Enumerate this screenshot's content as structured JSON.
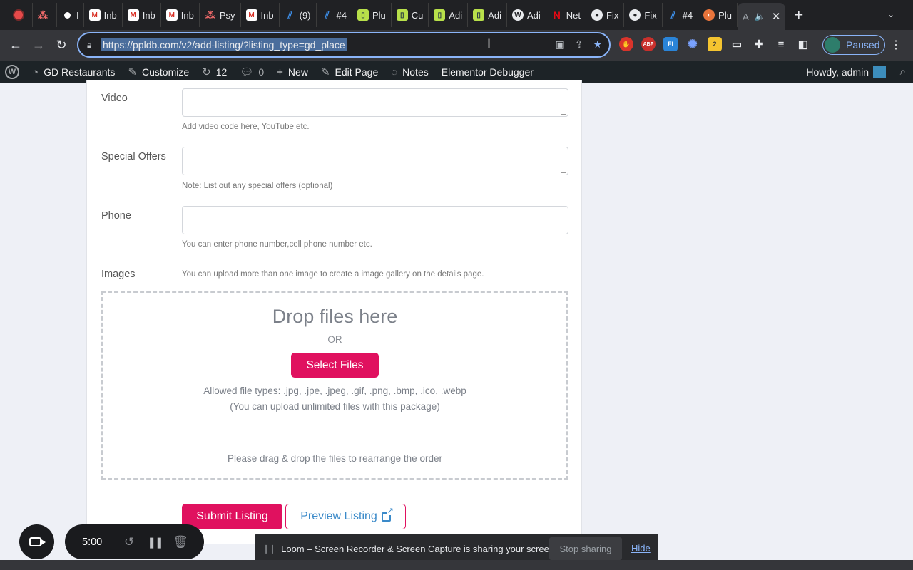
{
  "browser": {
    "tabs": [
      {
        "label": "",
        "icon": "recording-icon",
        "fav": "rec",
        "narrow": true
      },
      {
        "label": "",
        "icon": "asana-icon",
        "fav": "asana",
        "narrow": true
      },
      {
        "label": "I",
        "icon": "dot-icon",
        "fav": "dot",
        "narrow": true
      },
      {
        "label": "Inb",
        "icon": "gmail-icon",
        "fav": "gmail"
      },
      {
        "label": "Inb",
        "icon": "gmail-icon",
        "fav": "gmail"
      },
      {
        "label": "Inb",
        "icon": "gmail-icon",
        "fav": "gmail"
      },
      {
        "label": "Psy",
        "icon": "asana-icon",
        "fav": "asana"
      },
      {
        "label": "Inb",
        "icon": "gmail-icon",
        "fav": "gmail"
      },
      {
        "label": "(9)",
        "icon": "zenhub-icon",
        "fav": "zen"
      },
      {
        "label": "#4",
        "icon": "zenhub-icon",
        "fav": "zen"
      },
      {
        "label": "Plu",
        "icon": "plugin-icon",
        "fav": "plug"
      },
      {
        "label": "Cu",
        "icon": "plugin-icon",
        "fav": "plug"
      },
      {
        "label": "Adi",
        "icon": "plugin-icon",
        "fav": "plug"
      },
      {
        "label": "Adi",
        "icon": "plugin-icon",
        "fav": "plug"
      },
      {
        "label": "Adi",
        "icon": "wordpress-icon",
        "fav": "wp"
      },
      {
        "label": "Net",
        "icon": "netflix-icon",
        "fav": "netflix"
      },
      {
        "label": "Fix",
        "icon": "github-icon",
        "fav": "gh"
      },
      {
        "label": "Fix",
        "icon": "github-icon",
        "fav": "gh"
      },
      {
        "label": "#4",
        "icon": "zenhub-icon",
        "fav": "zen"
      },
      {
        "label": "Plu",
        "icon": "orange-icon",
        "fav": "orange"
      }
    ],
    "active_tab_label": "A",
    "new_tab": "+",
    "url": "https://ppldb.com/v2/add-listing/?listing_type=gd_place",
    "profile_label": "Paused"
  },
  "wpbar": {
    "site_name": "GD Restaurants",
    "customize": "Customize",
    "updates_count": "12",
    "comments_count": "0",
    "new_label": "New",
    "edit_page": "Edit Page",
    "notes": "Notes",
    "elementor_debugger": "Elementor Debugger",
    "howdy": "Howdy, admin"
  },
  "form": {
    "video": {
      "label": "Video",
      "note": "Add video code here, YouTube etc."
    },
    "special_offers": {
      "label": "Special Offers",
      "note": "Note: List out any special offers (optional)"
    },
    "phone": {
      "label": "Phone",
      "note": "You can enter phone number,cell phone number etc."
    },
    "images": {
      "label": "Images",
      "note": "You can upload more than one image to create a image gallery on the details page.",
      "drop_title": "Drop files here",
      "or": "OR",
      "select_button": "Select Files",
      "allowed_types": "Allowed file types: .jpg, .jpe, .jpeg, .gif, .png, .bmp, .ico, .webp",
      "limit": "(You can upload unlimited files with this package)",
      "reorder": "Please drag & drop the files to rearrange the order"
    },
    "submit_button": "Submit Listing",
    "preview_button": "Preview Listing"
  },
  "loom": {
    "timer": "5:00",
    "share_message": "Loom – Screen Recorder & Screen Capture is sharing your screen.",
    "stop_sharing": "Stop sharing",
    "hide": "Hide"
  },
  "colors": {
    "accent": "#e0115f",
    "link": "#3b8ac9",
    "wpbar_bg": "#1d2327",
    "browser_bg": "#202124"
  }
}
